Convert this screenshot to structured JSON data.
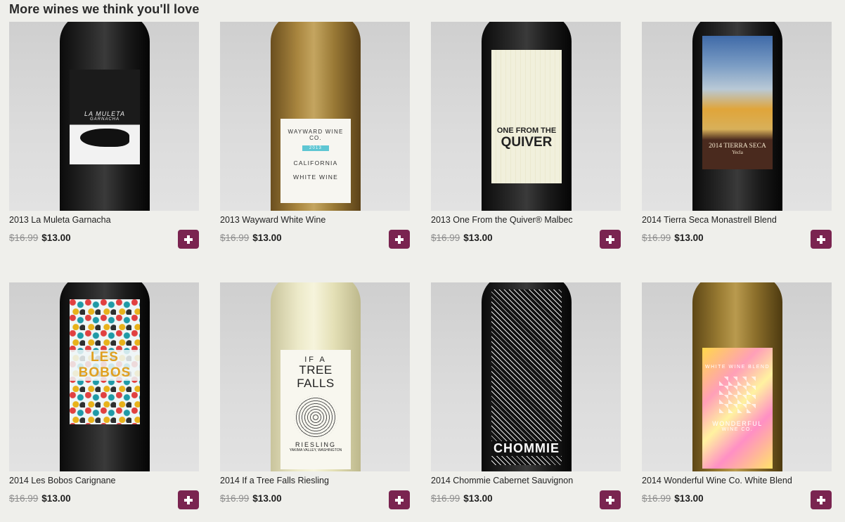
{
  "section": {
    "title": "More wines we think you'll love"
  },
  "wines": [
    {
      "name": "2013 La Muleta Garnacha",
      "old_price": "$16.99",
      "price": "$13.00",
      "label_lines": [
        "LA MULETA",
        "GARNACHA"
      ]
    },
    {
      "name": "2013 Wayward White Wine",
      "old_price": "$16.99",
      "price": "$13.00",
      "label_lines": [
        "WAYWARD WINE CO.",
        "2013",
        "CALIFORNIA",
        "WHITE WINE"
      ]
    },
    {
      "name": "2013 One From the Quiver® Malbec",
      "old_price": "$16.99",
      "price": "$13.00",
      "label_lines": [
        "ONE FROM THE",
        "QUIVER"
      ]
    },
    {
      "name": "2014 Tierra Seca Monastrell Blend",
      "old_price": "$16.99",
      "price": "$13.00",
      "label_lines": [
        "2014 TIERRA SECA",
        "Yecla"
      ]
    },
    {
      "name": "2014 Les Bobos Carignane",
      "old_price": "$16.99",
      "price": "$13.00",
      "label_lines": [
        "LES BOBOS"
      ]
    },
    {
      "name": "2014 If a Tree Falls Riesling",
      "old_price": "$16.99",
      "price": "$13.00",
      "label_lines": [
        "IF A",
        "TREE FALLS",
        "RIESLING",
        "YAKIMA VALLEY, WASHINGTON"
      ]
    },
    {
      "name": "2014 Chommie Cabernet Sauvignon",
      "old_price": "$16.99",
      "price": "$13.00",
      "label_lines": [
        "CHOMMIE"
      ]
    },
    {
      "name": "2014 Wonderful Wine Co. White Blend",
      "old_price": "$16.99",
      "price": "$13.00",
      "label_lines": [
        "WHITE WINE BLEND",
        "WONDERFUL",
        "WINE CO."
      ]
    }
  ],
  "add_button_icon": "plus-icon",
  "colors": {
    "accent": "#7a2450",
    "background": "#efefeb"
  }
}
